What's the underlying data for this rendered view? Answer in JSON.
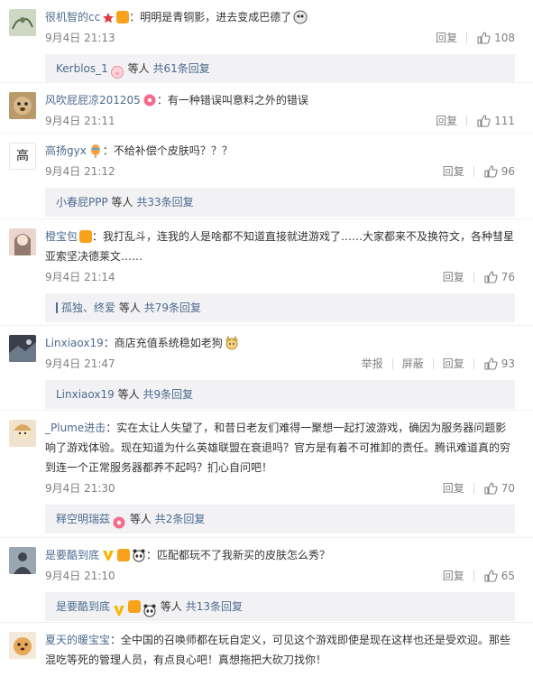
{
  "comments": [
    {
      "user": "很机智的cc",
      "text": "明明是青铜影，进去变成巴德了",
      "time": "9月4日 21:13",
      "reply_label": "回复",
      "likes": "108",
      "thread": {
        "user": "Kerblos_1",
        "sep": "等人",
        "link": "共61条回复"
      }
    },
    {
      "user": "风吹屁屁凉201205",
      "text": "有一种错误叫意料之外的错误",
      "time": "9月4日 21:11",
      "reply_label": "回复",
      "likes": "111"
    },
    {
      "user": "高扬gyx",
      "text": "不给补偿个皮肤吗？？？",
      "time": "9月4日 21:12",
      "reply_label": "回复",
      "likes": "96",
      "avatar_char": "高",
      "thread": {
        "user": "小春屁PPP",
        "sep": "等人",
        "link": "共33条回复"
      }
    },
    {
      "user": "橙宝包",
      "text": "我打乱斗，连我的人是啥都不知道直接就进游戏了……大家都来不及换符文，各种彗星亚索坚决德莱文……",
      "time": "9月4日 21:14",
      "reply_label": "回复",
      "likes": "76",
      "thread": {
        "user": "孤独、终爱",
        "sep": "等人",
        "link": "共79条回复"
      }
    },
    {
      "user": "Linxiaox19",
      "text": "商店充值系统稳如老狗",
      "time": "9月4日 21:47",
      "report_label": "举报",
      "block_label": "屏蔽",
      "reply_label": "回复",
      "likes": "93",
      "thread": {
        "user": "Linxiaox19",
        "sep": "等人",
        "link": "共9条回复"
      }
    },
    {
      "user": "_Plume进击",
      "text": "实在太让人失望了，和昔日老友们难得一聚想一起打波游戏，确因为服务器问题影响了游戏体验。现在知道为什么英雄联盟在衰退吗？官方是有着不可推卸的责任。腾讯难道真的穷到连一个正常服务器都养不起吗？扪心自问吧！",
      "time": "9月4日 21:30",
      "reply_label": "回复",
      "likes": "70",
      "thread": {
        "user": "释空明瑞茲",
        "sep": "等人",
        "link": "共2条回复"
      }
    },
    {
      "user": "是要酷到底",
      "text": "匹配都玩不了我新买的皮肤怎么秀？",
      "time": "9月4日 21:10",
      "reply_label": "回复",
      "likes": "65",
      "thread": {
        "user": "是要酷到底",
        "sep": "等人",
        "link": "共13条回复"
      }
    },
    {
      "user": "夏天的暖宝宝",
      "text": "全中国的召唤师都在玩自定义，可见这个游戏即使是现在这样也还是受欢迎。那些混吃等死的管理人员，有点良心吧！真想拖把大砍刀找你！"
    }
  ],
  "colon": "：",
  "colors": {
    "username": "#eb7350",
    "link": "#4d6b8f",
    "meta": "#808080",
    "thread_bg": "#f2f2f5"
  }
}
